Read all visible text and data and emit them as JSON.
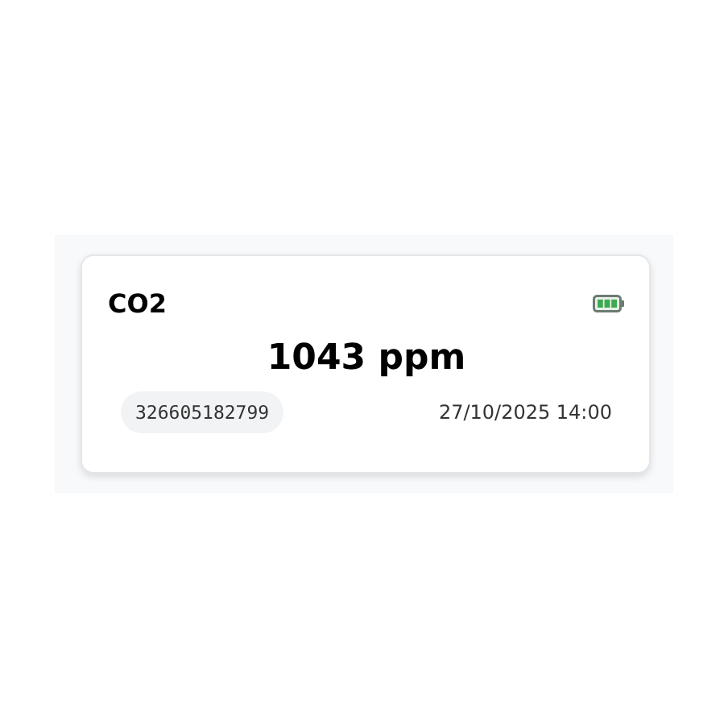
{
  "sensor": {
    "name": "CO2",
    "reading": "1043 ppm",
    "device_id": "326605182799",
    "timestamp": "27/10/2025 14:00"
  }
}
